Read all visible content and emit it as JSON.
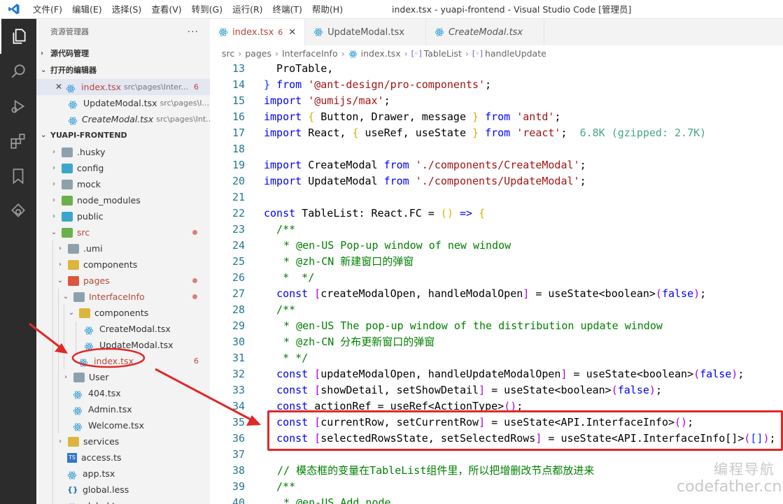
{
  "titlebar": {
    "menu": [
      "文件(F)",
      "编辑(E)",
      "选择(S)",
      "查看(V)",
      "转到(G)",
      "运行(R)",
      "终端(T)",
      "帮助(H)"
    ],
    "title": "index.tsx - yuapi-frontend - Visual Studio Code [管理员]"
  },
  "sidebar": {
    "header": "资源管理器",
    "more": "···",
    "source_control": "源代码管理",
    "open_editors_title": "打开的编辑器",
    "open_editors": [
      {
        "close": "✕",
        "name": "index.tsx",
        "path": "src\\pages\\Inter...",
        "badge": "6"
      },
      {
        "name": "UpdateModal.tsx",
        "path": "src\\pages\\I..."
      },
      {
        "name": "CreateModal.tsx",
        "path": "src\\pages\\Int..."
      }
    ],
    "project_title": "YUAPI-FRONTEND",
    "tree": {
      "husky": ".husky",
      "config": "config",
      "mock": "mock",
      "node_modules": "node_modules",
      "public": "public",
      "src": "src",
      "umi": ".umi",
      "components": "components",
      "pages": "pages",
      "interfaceinfo": "InterfaceInfo",
      "components2": "components",
      "createmodal": "CreateModal.tsx",
      "updatemodal": "UpdateModal.tsx",
      "index": "index.tsx",
      "index_badge": "6",
      "user": "User",
      "f404": "404.tsx",
      "admin": "Admin.tsx",
      "welcome": "Welcome.tsx",
      "services": "services",
      "access": "access.ts",
      "app": "app.tsx",
      "globalless": "global.less",
      "globaltsx": "global.tsx"
    }
  },
  "tabs": [
    {
      "label": "index.tsx",
      "badge": "6",
      "close": "✕"
    },
    {
      "label": "UpdateModal.tsx"
    },
    {
      "label": "CreateModal.tsx"
    }
  ],
  "breadcrumb": [
    "src",
    "pages",
    "InterfaceInfo",
    "index.tsx",
    "TableList",
    "handleUpdate"
  ],
  "code": {
    "l13": "13",
    "l14": "14",
    "l15": "15",
    "l16": "16",
    "l17": "17",
    "l18": "18",
    "l19": "19",
    "l20": "20",
    "l21": "21",
    "l22": "22",
    "l23": "23",
    "l24": "24",
    "l25": "25",
    "l26": "26",
    "l27": "27",
    "l28": "28",
    "l29": "29",
    "l30": "30",
    "l31": "31",
    "l32": "32",
    "l33": "33",
    "l34": "34",
    "l35": "35",
    "l36": "36",
    "l37": "37",
    "l38": "38",
    "l39": "39",
    "l40": "40",
    "size_hint": "6.8K (gzipped: 2.7K)",
    "c24": " * @en-US Pop-up window of new window",
    "c25": " * @zh-CN 新建窗口的弹窗",
    "c29": " * @en-US The pop-up window of the distribution update window",
    "c30": " * @zh-CN 分布更新窗口的弹窗",
    "c38": "// 模态框的变量在TableList组件里，所以把增删改节点都放进来",
    "c40": " * @en-US Add node"
  },
  "watermark": {
    "line1": "编程导航",
    "line2": "codefather.cn"
  },
  "colors": {
    "annotation": "#e02828",
    "activity_bar": "#2c2c2c",
    "keyword": "#0000ff",
    "string": "#a31515",
    "comment": "#008000"
  }
}
